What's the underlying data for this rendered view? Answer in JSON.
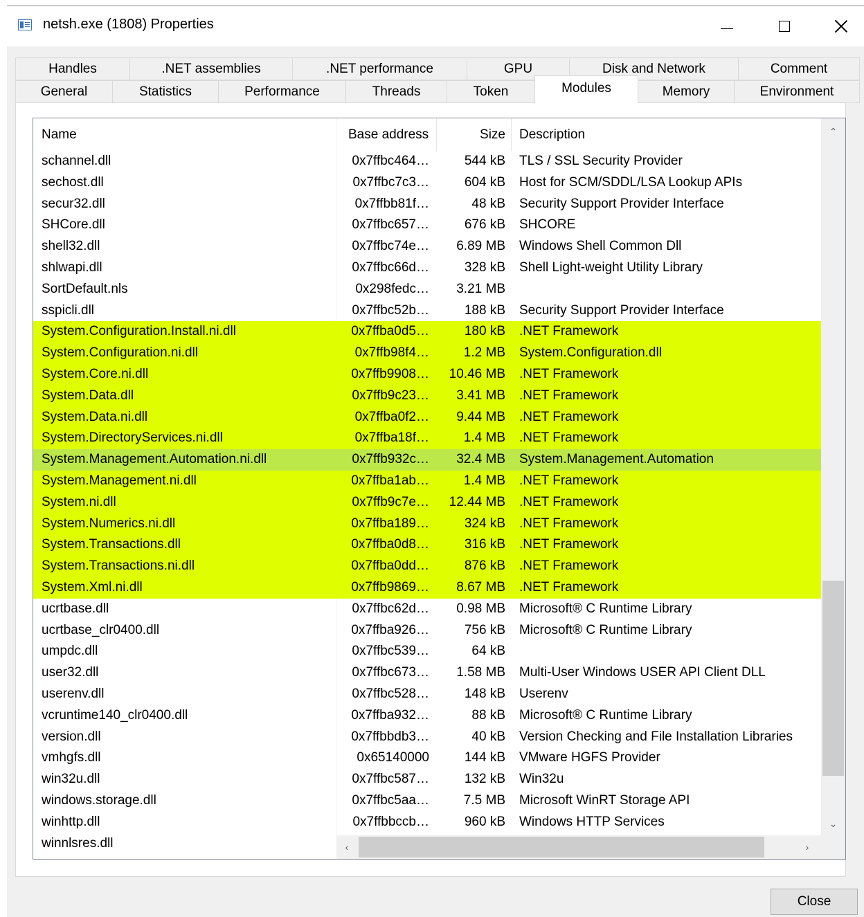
{
  "window": {
    "title": "netsh.exe (1808) Properties",
    "icon": "app-window-icon"
  },
  "tabs_top": [
    "Handles",
    ".NET assemblies",
    ".NET performance",
    "GPU",
    "Disk and Network",
    "Comment"
  ],
  "tabs_bottom": [
    "General",
    "Statistics",
    "Performance",
    "Threads",
    "Token",
    "Modules",
    "Memory",
    "Environment"
  ],
  "active_tab": "Modules",
  "columns": {
    "name": "Name",
    "base": "Base address",
    "size": "Size",
    "desc": "Description"
  },
  "colors": {
    "highlight": "#dfff00",
    "selected": "#bde84a"
  },
  "rows": [
    {
      "name": "schannel.dll",
      "base": "0x7ffbc464…",
      "size": "544 kB",
      "desc": "TLS / SSL Security Provider",
      "hl": false
    },
    {
      "name": "sechost.dll",
      "base": "0x7ffbc7c3…",
      "size": "604 kB",
      "desc": "Host for SCM/SDDL/LSA Lookup APIs",
      "hl": false
    },
    {
      "name": "secur32.dll",
      "base": "0x7ffbb81f…",
      "size": "48 kB",
      "desc": "Security Support Provider Interface",
      "hl": false
    },
    {
      "name": "SHCore.dll",
      "base": "0x7ffbc657…",
      "size": "676 kB",
      "desc": "SHCORE",
      "hl": false
    },
    {
      "name": "shell32.dll",
      "base": "0x7ffbc74e…",
      "size": "6.89 MB",
      "desc": "Windows Shell Common Dll",
      "hl": false
    },
    {
      "name": "shlwapi.dll",
      "base": "0x7ffbc66d…",
      "size": "328 kB",
      "desc": "Shell Light-weight Utility Library",
      "hl": false
    },
    {
      "name": "SortDefault.nls",
      "base": "0x298fedc…",
      "size": "3.21 MB",
      "desc": "",
      "hl": false
    },
    {
      "name": "sspicli.dll",
      "base": "0x7ffbc52b…",
      "size": "188 kB",
      "desc": "Security Support Provider Interface",
      "hl": false
    },
    {
      "name": "System.Configuration.Install.ni.dll",
      "base": "0x7ffba0d5…",
      "size": "180 kB",
      "desc": ".NET Framework",
      "hl": true
    },
    {
      "name": "System.Configuration.ni.dll",
      "base": "0x7ffb98f4…",
      "size": "1.2 MB",
      "desc": "System.Configuration.dll",
      "hl": true
    },
    {
      "name": "System.Core.ni.dll",
      "base": "0x7ffb9908…",
      "size": "10.46 MB",
      "desc": ".NET Framework",
      "hl": true
    },
    {
      "name": "System.Data.dll",
      "base": "0x7ffb9c23…",
      "size": "3.41 MB",
      "desc": ".NET Framework",
      "hl": true
    },
    {
      "name": "System.Data.ni.dll",
      "base": "0x7ffba0f2…",
      "size": "9.44 MB",
      "desc": ".NET Framework",
      "hl": true
    },
    {
      "name": "System.DirectoryServices.ni.dll",
      "base": "0x7ffba18f…",
      "size": "1.4 MB",
      "desc": ".NET Framework",
      "hl": true
    },
    {
      "name": "System.Management.Automation.ni.dll",
      "base": "0x7ffb932c…",
      "size": "32.4 MB",
      "desc": "System.Management.Automation",
      "hl": true,
      "selected": true
    },
    {
      "name": "System.Management.ni.dll",
      "base": "0x7ffba1ab…",
      "size": "1.4 MB",
      "desc": ".NET Framework",
      "hl": true
    },
    {
      "name": "System.ni.dll",
      "base": "0x7ffb9c7e…",
      "size": "12.44 MB",
      "desc": ".NET Framework",
      "hl": true
    },
    {
      "name": "System.Numerics.ni.dll",
      "base": "0x7ffba189…",
      "size": "324 kB",
      "desc": ".NET Framework",
      "hl": true
    },
    {
      "name": "System.Transactions.dll",
      "base": "0x7ffba0d8…",
      "size": "316 kB",
      "desc": ".NET Framework",
      "hl": true
    },
    {
      "name": "System.Transactions.ni.dll",
      "base": "0x7ffba0dd…",
      "size": "876 kB",
      "desc": ".NET Framework",
      "hl": true
    },
    {
      "name": "System.Xml.ni.dll",
      "base": "0x7ffb9869…",
      "size": "8.67 MB",
      "desc": ".NET Framework",
      "hl": true
    },
    {
      "name": "ucrtbase.dll",
      "base": "0x7ffbc62d…",
      "size": "0.98 MB",
      "desc": "Microsoft® C Runtime Library",
      "hl": false
    },
    {
      "name": "ucrtbase_clr0400.dll",
      "base": "0x7ffba926…",
      "size": "756 kB",
      "desc": "Microsoft® C Runtime Library",
      "hl": false
    },
    {
      "name": "umpdc.dll",
      "base": "0x7ffbc539…",
      "size": "64 kB",
      "desc": "",
      "hl": false
    },
    {
      "name": "user32.dll",
      "base": "0x7ffbc673…",
      "size": "1.58 MB",
      "desc": "Multi-User Windows USER API Client DLL",
      "hl": false
    },
    {
      "name": "userenv.dll",
      "base": "0x7ffbc528…",
      "size": "148 kB",
      "desc": "Userenv",
      "hl": false
    },
    {
      "name": "vcruntime140_clr0400.dll",
      "base": "0x7ffba932…",
      "size": "88 kB",
      "desc": "Microsoft® C Runtime Library",
      "hl": false
    },
    {
      "name": "version.dll",
      "base": "0x7ffbbdb3…",
      "size": "40 kB",
      "desc": "Version Checking and File Installation Libraries",
      "hl": false
    },
    {
      "name": "vmhgfs.dll",
      "base": "0x65140000",
      "size": "144 kB",
      "desc": "VMware HGFS Provider",
      "hl": false
    },
    {
      "name": "win32u.dll",
      "base": "0x7ffbc587…",
      "size": "132 kB",
      "desc": "Win32u",
      "hl": false
    },
    {
      "name": "windows.storage.dll",
      "base": "0x7ffbc5aa…",
      "size": "7.5 MB",
      "desc": "Microsoft WinRT Storage API",
      "hl": false
    },
    {
      "name": "winhttp.dll",
      "base": "0x7ffbbccb…",
      "size": "960 kB",
      "desc": "Windows HTTP Services",
      "hl": false
    },
    {
      "name": "winnlsres.dll",
      "base": "",
      "size": "",
      "desc": "",
      "hl": false
    }
  ],
  "buttons": {
    "close": "Close"
  }
}
